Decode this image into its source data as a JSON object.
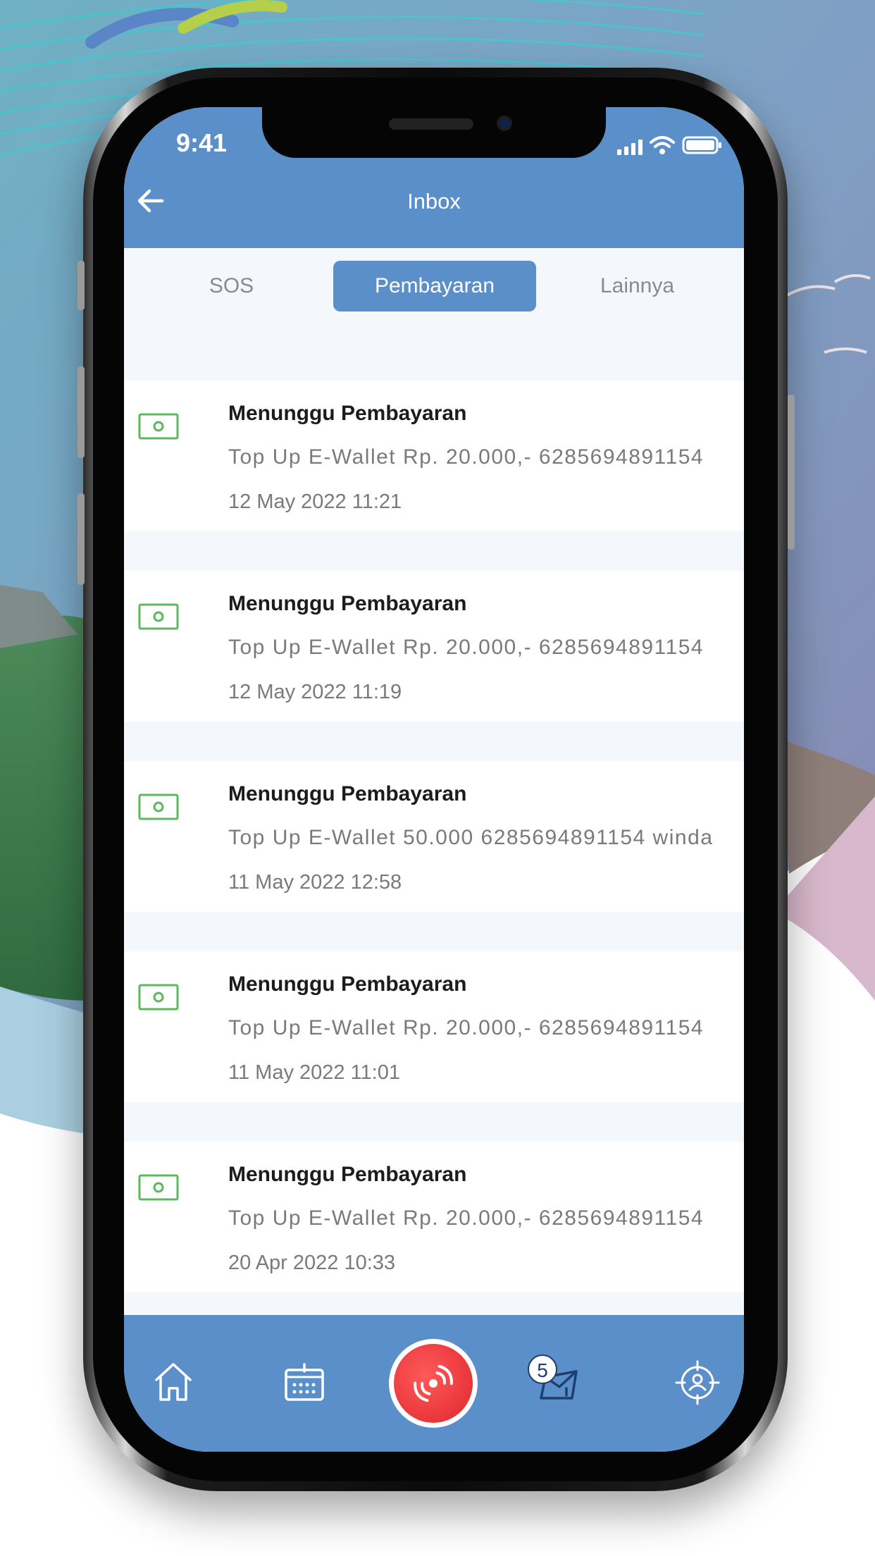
{
  "status_bar": {
    "time": "9:41"
  },
  "header": {
    "title": "Inbox"
  },
  "tabs": [
    {
      "label": "SOS",
      "active": false
    },
    {
      "label": "Pembayaran",
      "active": true
    },
    {
      "label": "Lainnya",
      "active": false
    }
  ],
  "messages": [
    {
      "title": "Menunggu Pembayaran",
      "description": "Top Up E-Wallet Rp. 20.000,- 6285694891154",
      "date": "12 May 2022 11:21"
    },
    {
      "title": "Menunggu Pembayaran",
      "description": "Top Up E-Wallet Rp. 20.000,- 6285694891154",
      "date": "12 May 2022 11:19"
    },
    {
      "title": "Menunggu Pembayaran",
      "description": "Top Up E-Wallet 50.000 6285694891154 winda",
      "date": "11 May 2022 12:58"
    },
    {
      "title": "Menunggu Pembayaran",
      "description": "Top Up E-Wallet Rp. 20.000,- 6285694891154",
      "date": "11 May 2022 11:01"
    },
    {
      "title": "Menunggu Pembayaran",
      "description": "Top Up E-Wallet Rp. 20.000,- 6285694891154",
      "date": "20 Apr 2022 10:33"
    }
  ],
  "bottom_nav": {
    "items": [
      {
        "icon": "home-icon"
      },
      {
        "icon": "calendar-icon"
      },
      {
        "icon": "sos-signal-icon"
      },
      {
        "icon": "mail-icon",
        "badge": "5"
      },
      {
        "icon": "location-target-icon"
      }
    ]
  },
  "colors": {
    "primary": "#5a8fca",
    "money_icon": "#5cb85c",
    "sos": "#e0262c"
  }
}
